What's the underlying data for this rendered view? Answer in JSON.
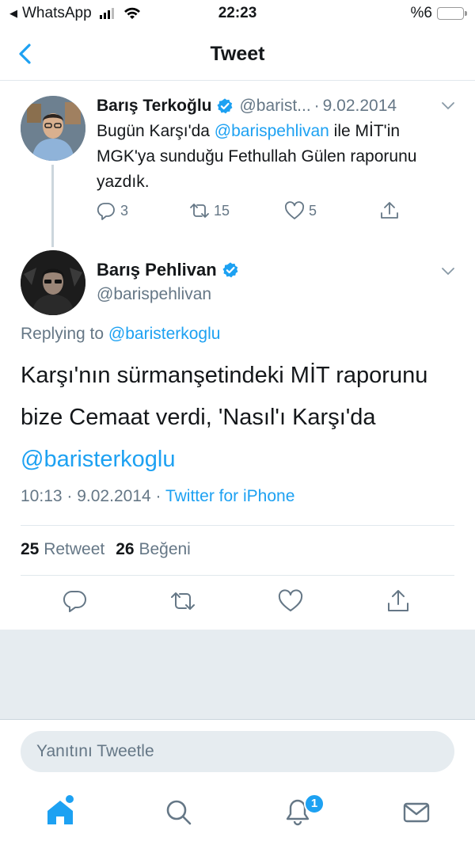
{
  "status_bar": {
    "back_app": "WhatsApp",
    "time": "22:23",
    "battery_label": "%6"
  },
  "nav": {
    "title": "Tweet"
  },
  "parent_tweet": {
    "name": "Barış Terkoğlu",
    "handle": "@barist...",
    "separator": "·",
    "date": "9.02.2014",
    "text_1": "Bugün Karşı'da ",
    "mention": "@barispehlivan",
    "text_2": " ile MİT'in MGK'ya sunduğu Fethullah Gülen raporunu yazdık.",
    "reply_count": "3",
    "retweet_count": "15",
    "like_count": "5"
  },
  "main_tweet": {
    "name": "Barış Pehlivan",
    "handle": "@barispehlivan",
    "replying_prefix": "Replying to ",
    "replying_handle": "@baristerkoglu",
    "text": "Karşı'nın sürmanşetindeki MİT raporunu bize Cemaat verdi, 'Nasıl'ı Karşı'da ",
    "text_mention": "@baristerkoglu",
    "time": "10:13",
    "meta_sep": " · ",
    "date": "9.02.2014",
    "source": "Twitter for iPhone",
    "retweets_count": "25",
    "retweets_label": "Retweet",
    "likes_count": "26",
    "likes_label": "Beğeni"
  },
  "compose": {
    "placeholder": "Yanıtını Tweetle"
  },
  "tab_bar": {
    "notification_badge": "1"
  },
  "colors": {
    "accent": "#1da1f2",
    "secondary_text": "#657786",
    "grey_background": "#e6ecf0"
  },
  "icons": [
    "back-icon",
    "verified-icon",
    "chevron-down-icon",
    "reply-icon",
    "retweet-icon",
    "like-icon",
    "share-icon",
    "home-icon",
    "search-icon",
    "notifications-icon",
    "messages-icon"
  ]
}
